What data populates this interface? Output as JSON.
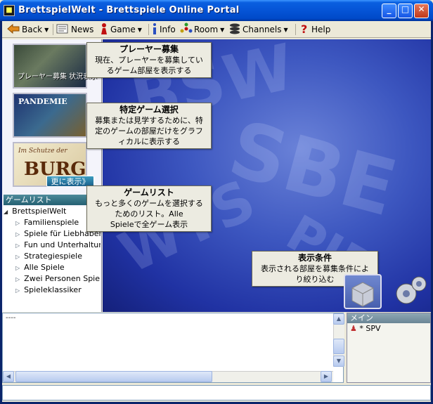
{
  "window": {
    "title": "BrettspielWelt - Brettspiele Online Portal"
  },
  "toolbar": {
    "back": "Back",
    "news": "News",
    "game": "Game",
    "info": "Info",
    "room": "Room",
    "channels": "Channels",
    "help": "Help"
  },
  "left": {
    "thumb1_caption": "プレーヤー募集 状況表示",
    "thumb2_title": "PANDEMIE",
    "thumb3_title": "Im Schutze der",
    "thumb3_burg": "BURG",
    "more_button": "更に表示》",
    "gamelist_header": "ゲームリスト",
    "tree_root": "BrettspielWelt",
    "tree_items": [
      "Familienspiele",
      "Spiele für Liebhaber",
      "Fun und Unterhaltung",
      "Strategiespiele",
      "Alle Spiele",
      "Zwei Personen Spiele",
      "Spieleklassiker"
    ]
  },
  "tips": {
    "t1": {
      "title": "プレーヤー募集",
      "body": [
        "現在、プレーヤーを募集してい",
        "るゲーム部屋を表示する"
      ]
    },
    "t2": {
      "title": "特定ゲーム選択",
      "body": [
        "募集または見学するために、特",
        "定のゲームの部屋だけをグラフ",
        "ィカルに表示する"
      ]
    },
    "t3": {
      "title": "ゲームリスト",
      "body": [
        "もっと多くのゲームを選択する",
        "ためのリスト。Alle",
        "Spieleで全ゲーム表示"
      ]
    },
    "t4": {
      "title": "表示条件",
      "body": [
        "表示される部屋を募集条件によ",
        "り絞り込む"
      ]
    }
  },
  "userlist": {
    "header": "メイン",
    "user": "* SPV"
  },
  "console": {
    "text": "----"
  },
  "icons": [
    "back-icon",
    "news-icon",
    "game-icon",
    "info-icon",
    "room-icon",
    "channels-icon",
    "help-icon",
    "box-icon",
    "gear-icon"
  ]
}
